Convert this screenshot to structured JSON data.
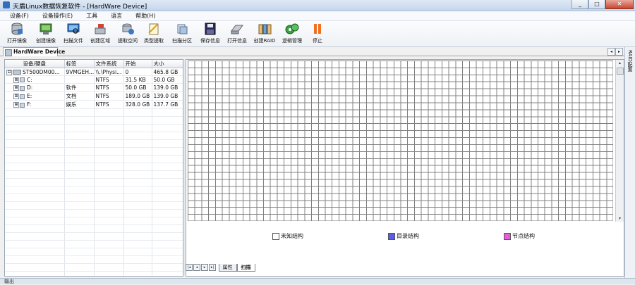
{
  "window": {
    "title": "天盾Linux数据恢复软件 - [HardWare Device]",
    "controls": [
      "_",
      "□",
      "✕"
    ]
  },
  "menu": [
    "设备(F)",
    "设备操作(E)",
    "工具",
    "语言",
    "帮助(H)"
  ],
  "toolbar": [
    {
      "label": "打开镜像",
      "icon": "open-image-icon"
    },
    {
      "label": "创建镜像",
      "icon": "create-image-icon"
    },
    {
      "label": "扫描文件",
      "icon": "scan-files-icon"
    },
    {
      "label": "创建区域",
      "icon": "create-region-icon"
    },
    {
      "label": "提取空间",
      "icon": "extract-space-icon"
    },
    {
      "label": "类型提取",
      "icon": "type-extract-icon"
    },
    {
      "label": "扫描分区",
      "icon": "scan-partition-icon"
    },
    {
      "label": "保存信息",
      "icon": "save-info-icon"
    },
    {
      "label": "打开信息",
      "icon": "open-info-icon"
    },
    {
      "label": "创建RAID",
      "icon": "create-raid-icon"
    },
    {
      "label": "逻辑管理",
      "icon": "logic-manage-icon"
    },
    {
      "label": "停止",
      "icon": "stop-icon"
    }
  ],
  "tabs": {
    "active": "HardWare Device",
    "nav": [
      "◂",
      "▸"
    ]
  },
  "side_tab": "RAID配置",
  "device_table": {
    "columns": [
      "设备/硬盘",
      "标签",
      "文件系统",
      "开始",
      "大小"
    ],
    "rows": [
      {
        "name": "ST500DM00...",
        "label": "9VMGEH...",
        "fs": "\\\\.\\Physi...",
        "start": "0",
        "size": "465.8 GB",
        "expander": "⊟",
        "level": 0
      },
      {
        "name": "C:",
        "label": "",
        "fs": "NTFS",
        "start": "31.5 KB",
        "size": "50.0 GB",
        "expander": "⊞",
        "level": 1
      },
      {
        "name": "D:",
        "label": "软件",
        "fs": "NTFS",
        "start": "50.0 GB",
        "size": "139.0 GB",
        "expander": "⊞",
        "level": 1
      },
      {
        "name": "E:",
        "label": "文档",
        "fs": "NTFS",
        "start": "189.0 GB",
        "size": "139.0 GB",
        "expander": "⊞",
        "level": 1
      },
      {
        "name": "F:",
        "label": "娱乐",
        "fs": "NTFS",
        "start": "328.0 GB",
        "size": "137.7 GB",
        "expander": "⊞",
        "level": 1
      }
    ]
  },
  "cluster_map": {
    "columns": 62,
    "rows": 23,
    "cell_color": "#ffffff",
    "line_color": "#808080"
  },
  "legend": [
    {
      "label": "未知结构",
      "color": "#ffffff"
    },
    {
      "label": "目录结构",
      "color": "#5b5bf0"
    },
    {
      "label": "节点结构",
      "color": "#e85ae0"
    }
  ],
  "bottom_tabs": {
    "nav": [
      "|◂",
      "◂",
      "▸",
      "▸|"
    ],
    "tabs": [
      "属性",
      "扫描"
    ],
    "active": "扫描"
  },
  "status": {
    "text": "输出"
  },
  "scrollbar": {
    "up": "▴",
    "down": "▾"
  }
}
